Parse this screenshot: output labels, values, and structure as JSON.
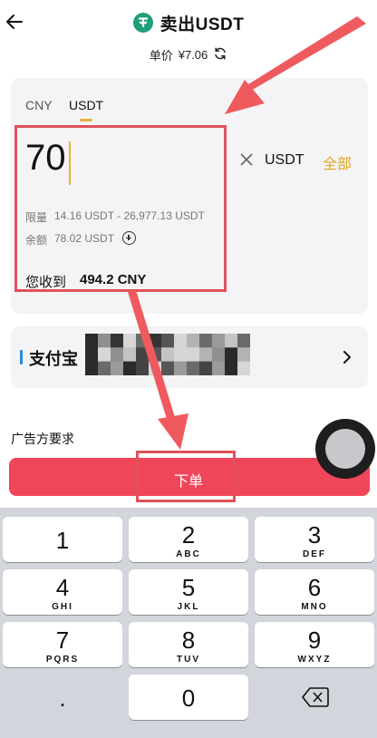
{
  "header": {
    "title": "卖出USDT",
    "price_label": "单价",
    "price_value": "¥7.06"
  },
  "form": {
    "tabs": [
      "CNY",
      "USDT"
    ],
    "active_tab": "USDT",
    "amount": "70",
    "unit": "USDT",
    "all_label": "全部",
    "limit_label": "限量",
    "limit_value": "14.16 USDT - 26,977.13 USDT",
    "balance_label": "余额",
    "balance_value": "78.02 USDT",
    "receive_label": "您收到",
    "receive_value": "494.2 CNY"
  },
  "payment": {
    "method": "支付宝"
  },
  "requirements_label": "广告方要求",
  "order_button": "下单",
  "keyboard": {
    "keys": [
      {
        "digit": "1",
        "letters": ""
      },
      {
        "digit": "2",
        "letters": "ABC"
      },
      {
        "digit": "3",
        "letters": "DEF"
      },
      {
        "digit": "4",
        "letters": "GHI"
      },
      {
        "digit": "5",
        "letters": "JKL"
      },
      {
        "digit": "6",
        "letters": "MNO"
      },
      {
        "digit": "7",
        "letters": "PQRS"
      },
      {
        "digit": "8",
        "letters": "TUV"
      },
      {
        "digit": "9",
        "letters": "WXYZ"
      }
    ],
    "dot": ".",
    "zero": "0"
  },
  "colors": {
    "accent": "#e3a823",
    "order_button": "#f0465a",
    "tether": "#1f9e7a",
    "annotation_red": "#e0525a"
  }
}
